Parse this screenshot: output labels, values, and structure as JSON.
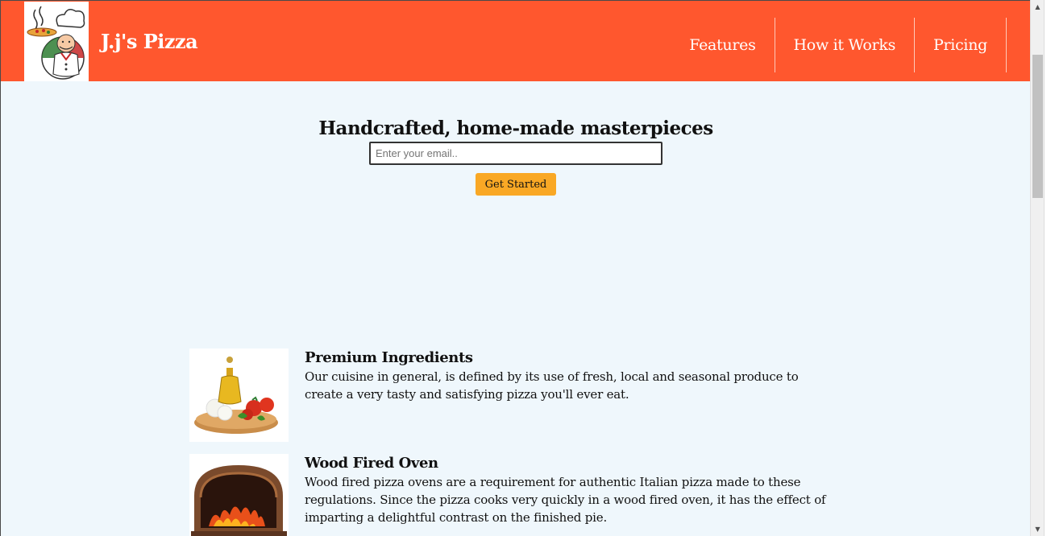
{
  "header": {
    "brand": "J.j's Pizza",
    "nav": [
      {
        "label": "Features"
      },
      {
        "label": "How it Works"
      },
      {
        "label": "Pricing"
      }
    ],
    "bg_color": "#ff572e"
  },
  "hero": {
    "title": "Handcrafted, home-made masterpieces",
    "email_placeholder": "Enter your email..",
    "cta_label": "Get Started",
    "cta_color": "#f9a825"
  },
  "features": [
    {
      "title": "Premium Ingredients",
      "description": "Our cuisine in general, is defined by its use of fresh, local and seasonal produce to create a very tasty and satisfying pizza you'll ever eat.",
      "icon": "ingredients-image"
    },
    {
      "title": "Wood Fired Oven",
      "description": "Wood fired pizza ovens are a requirement for authentic Italian pizza made to these regulations. Since the pizza cooks very quickly in a wood fired oven, it has the effect of imparting a delightful contrast on the finished pie.",
      "icon": "oven-image"
    }
  ],
  "scrollbar": {
    "up_glyph": "▲",
    "down_glyph": "▼"
  }
}
